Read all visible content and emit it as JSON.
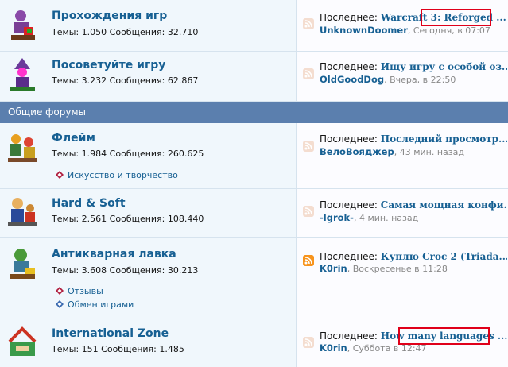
{
  "forums_top": [
    {
      "title": "Прохождения игр",
      "stats": "Темы: 1.050 Сообщения: 32.710",
      "last_prefix": "Последнее: ",
      "last_title": "Warcraft 3: Reforged ...",
      "last_user": "UnknownDoomer",
      "last_time": ", Сегодня, в 07:07"
    },
    {
      "title": "Посоветуйте игру",
      "stats": "Темы: 3.232 Сообщения: 62.867",
      "last_prefix": "Последнее: ",
      "last_title": "Ищу игру с особой оз...",
      "last_user": "OldGoodDog",
      "last_time": ", Вчера, в 22:50"
    }
  ],
  "section_title": "Общие форумы",
  "forums_general": [
    {
      "title": "Флейм",
      "stats": "Темы: 1.984 Сообщения: 260.625",
      "subforums": [
        "Искусство и творчество"
      ],
      "last_prefix": "Последнее: ",
      "last_title": "Последний просмотр...",
      "last_user": "ВелоВояджер",
      "last_time": ", 43 мин. назад"
    },
    {
      "title": "Hard & Soft",
      "stats": "Темы: 2.561 Сообщения: 108.440",
      "last_prefix": "Последнее: ",
      "last_title": "Самая мощная конфи...",
      "last_user": "-lgrok-",
      "last_time": ", 4 мин. назад"
    },
    {
      "title": "Антикварная лавка",
      "stats": "Темы: 3.608 Сообщения: 30.213",
      "subforums": [
        "Отзывы",
        "Обмен играми"
      ],
      "last_prefix": "Последнее: ",
      "last_title": "Куплю Croc 2 (Triada...",
      "last_user": "K0rin",
      "last_time": ", Воскресенье в 11:28"
    },
    {
      "title": "International Zone",
      "stats": "Темы: 151 Сообщения: 1.485",
      "last_prefix": "Последнее: ",
      "last_title": "How many languages ...",
      "last_user": "K0rin",
      "last_time": ", Суббота в 12:47"
    }
  ],
  "colors": {
    "link": "#176093",
    "section_bar": "#5b7fae",
    "highlight": "#e0001a",
    "rss_active": "#f7941d"
  }
}
